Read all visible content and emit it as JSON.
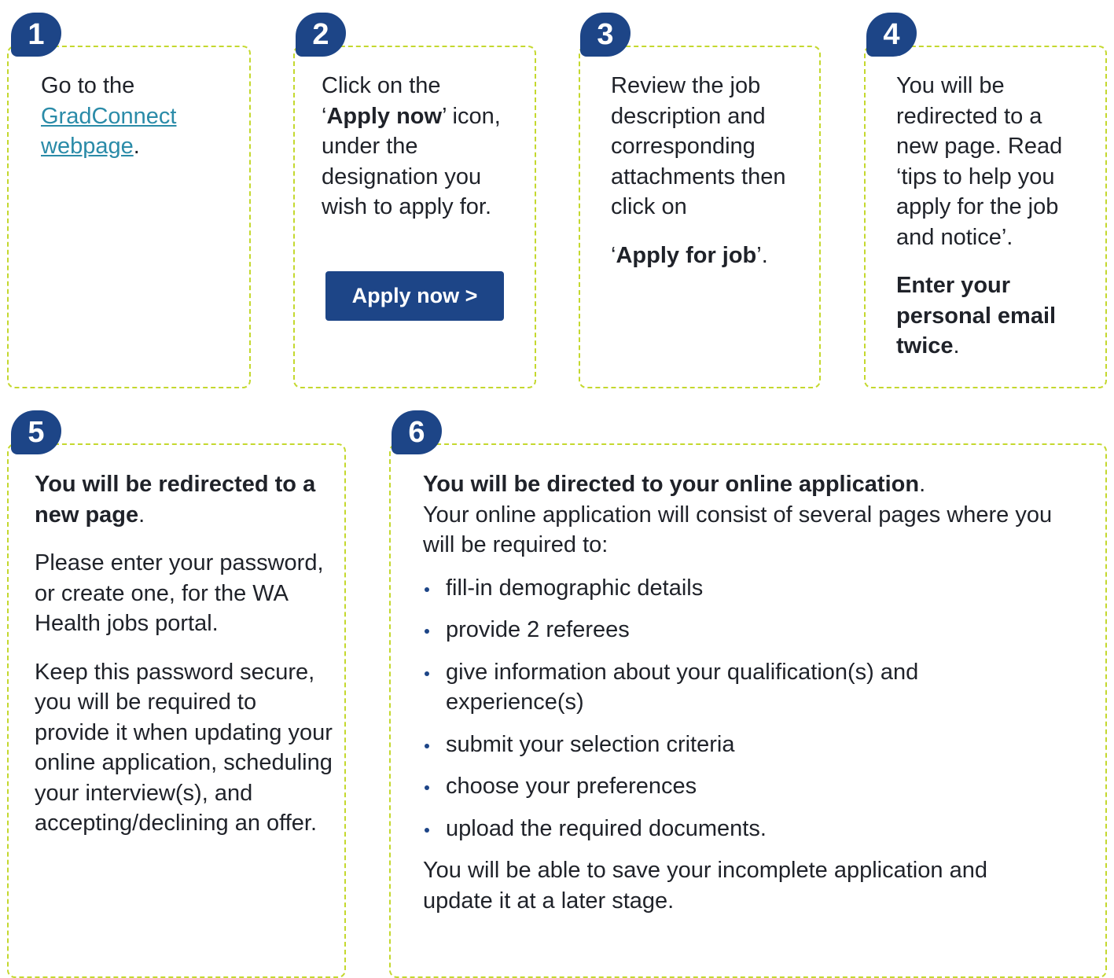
{
  "step1": {
    "number": "1",
    "text_before": "Go to the ",
    "link": "GradConnect webpage",
    "text_after": "."
  },
  "step2": {
    "number": "2",
    "line1": "Click on the",
    "quote_open": "‘",
    "bold": "Apply now",
    "quote_close": "’",
    "rest": "icon, under the designation you wish to apply for.",
    "button_label": "Apply now >"
  },
  "step3": {
    "number": "3",
    "text": "Review the job description and corresponding attachments then click on",
    "quote_open": "‘",
    "bold": "Apply for job",
    "quote_close": "’."
  },
  "step4": {
    "number": "4",
    "text": "You will be redirected to a new page. Read ‘tips to help you apply for the job and notice’.",
    "bold": "Enter your personal email twice",
    "after": "."
  },
  "step5": {
    "number": "5",
    "heading_bold": "You will be redirected to a new page",
    "heading_after": ".",
    "para1": "Please enter your password, or create one, for the WA Health jobs portal.",
    "para2": "Keep this password secure, you will be required to provide it when updating your online application, scheduling your interview(s), and accepting/declining an offer."
  },
  "step6": {
    "number": "6",
    "heading_bold": "You will be directed to your online application",
    "heading_after": ".",
    "intro": "Your online application will consist of several pages where you will be required to:",
    "bullets": [
      "fill-in demographic details",
      "provide 2 referees",
      "give information about your qualification(s) and experience(s)",
      "submit your selection criteria",
      "choose your preferences",
      "upload the required documents."
    ],
    "closing": "You will be able to save your incomplete application and update it at a later stage."
  },
  "colors": {
    "badge_navy": "#1d4587",
    "dashed_border_lime": "#c4d82e",
    "link_teal": "#2a8ba8"
  }
}
